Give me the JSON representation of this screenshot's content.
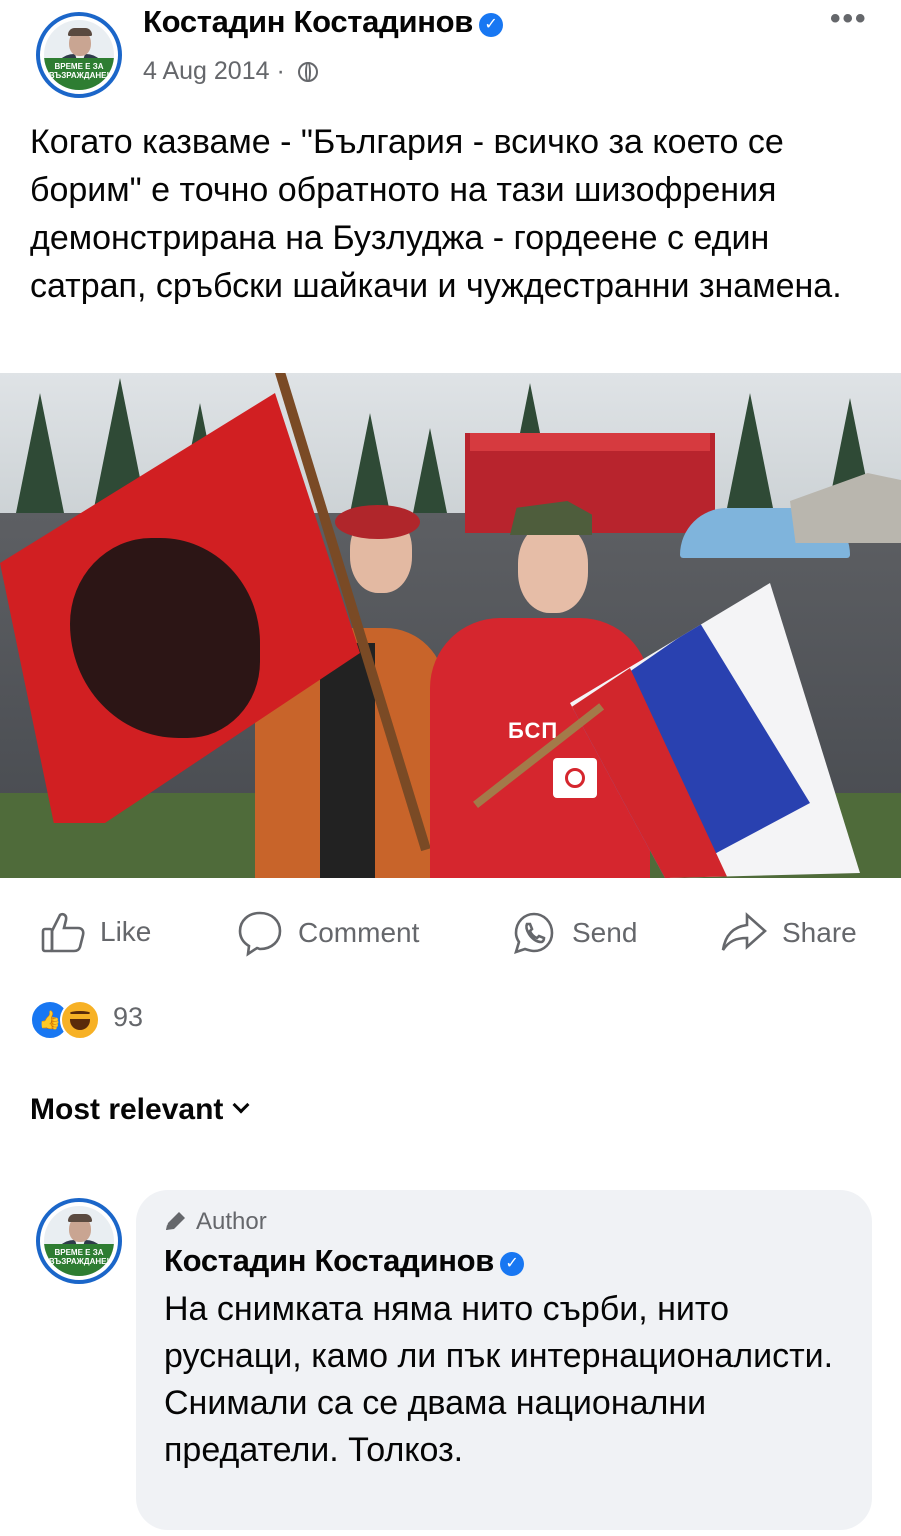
{
  "post": {
    "author_name": "Костадин Костадинов",
    "avatar_banner": "ВРЕМЕ Е ЗА ВЪЗРАЖДАНЕ!",
    "date": "4 Aug 2014",
    "separator": "·",
    "more_label": "•••",
    "text": "Когато казваме - \"България - всичко за което се борим\" е точно обратното на тази шизофрения демонстрирана на Бузлуджа - гордеене с един сатрап, сръбски шайкачи и чуждестранни знамена.",
    "photo_labels": {
      "shirt_text": "БСП"
    }
  },
  "actions": {
    "like": "Like",
    "comment": "Comment",
    "send": "Send",
    "share": "Share"
  },
  "reactions": {
    "count": "93",
    "types": [
      "like-icon",
      "haha-icon"
    ]
  },
  "sort": {
    "label": "Most relevant"
  },
  "comment": {
    "tag": "Author",
    "author_name": "Костадин Костадинов",
    "avatar_banner": "ВРЕМЕ Е ЗА ВЪЗРАЖДАНЕ!",
    "text": "На снимката няма нито сърби,  нито руснаци, камо ли пък интернационалисти. Снимали са се двама национални предатели. Толкоз."
  },
  "colors": {
    "accent": "#1877f2",
    "secondary_text": "#65676b",
    "bubble": "#f0f2f5",
    "avatar_ring": "#1b66c9"
  }
}
